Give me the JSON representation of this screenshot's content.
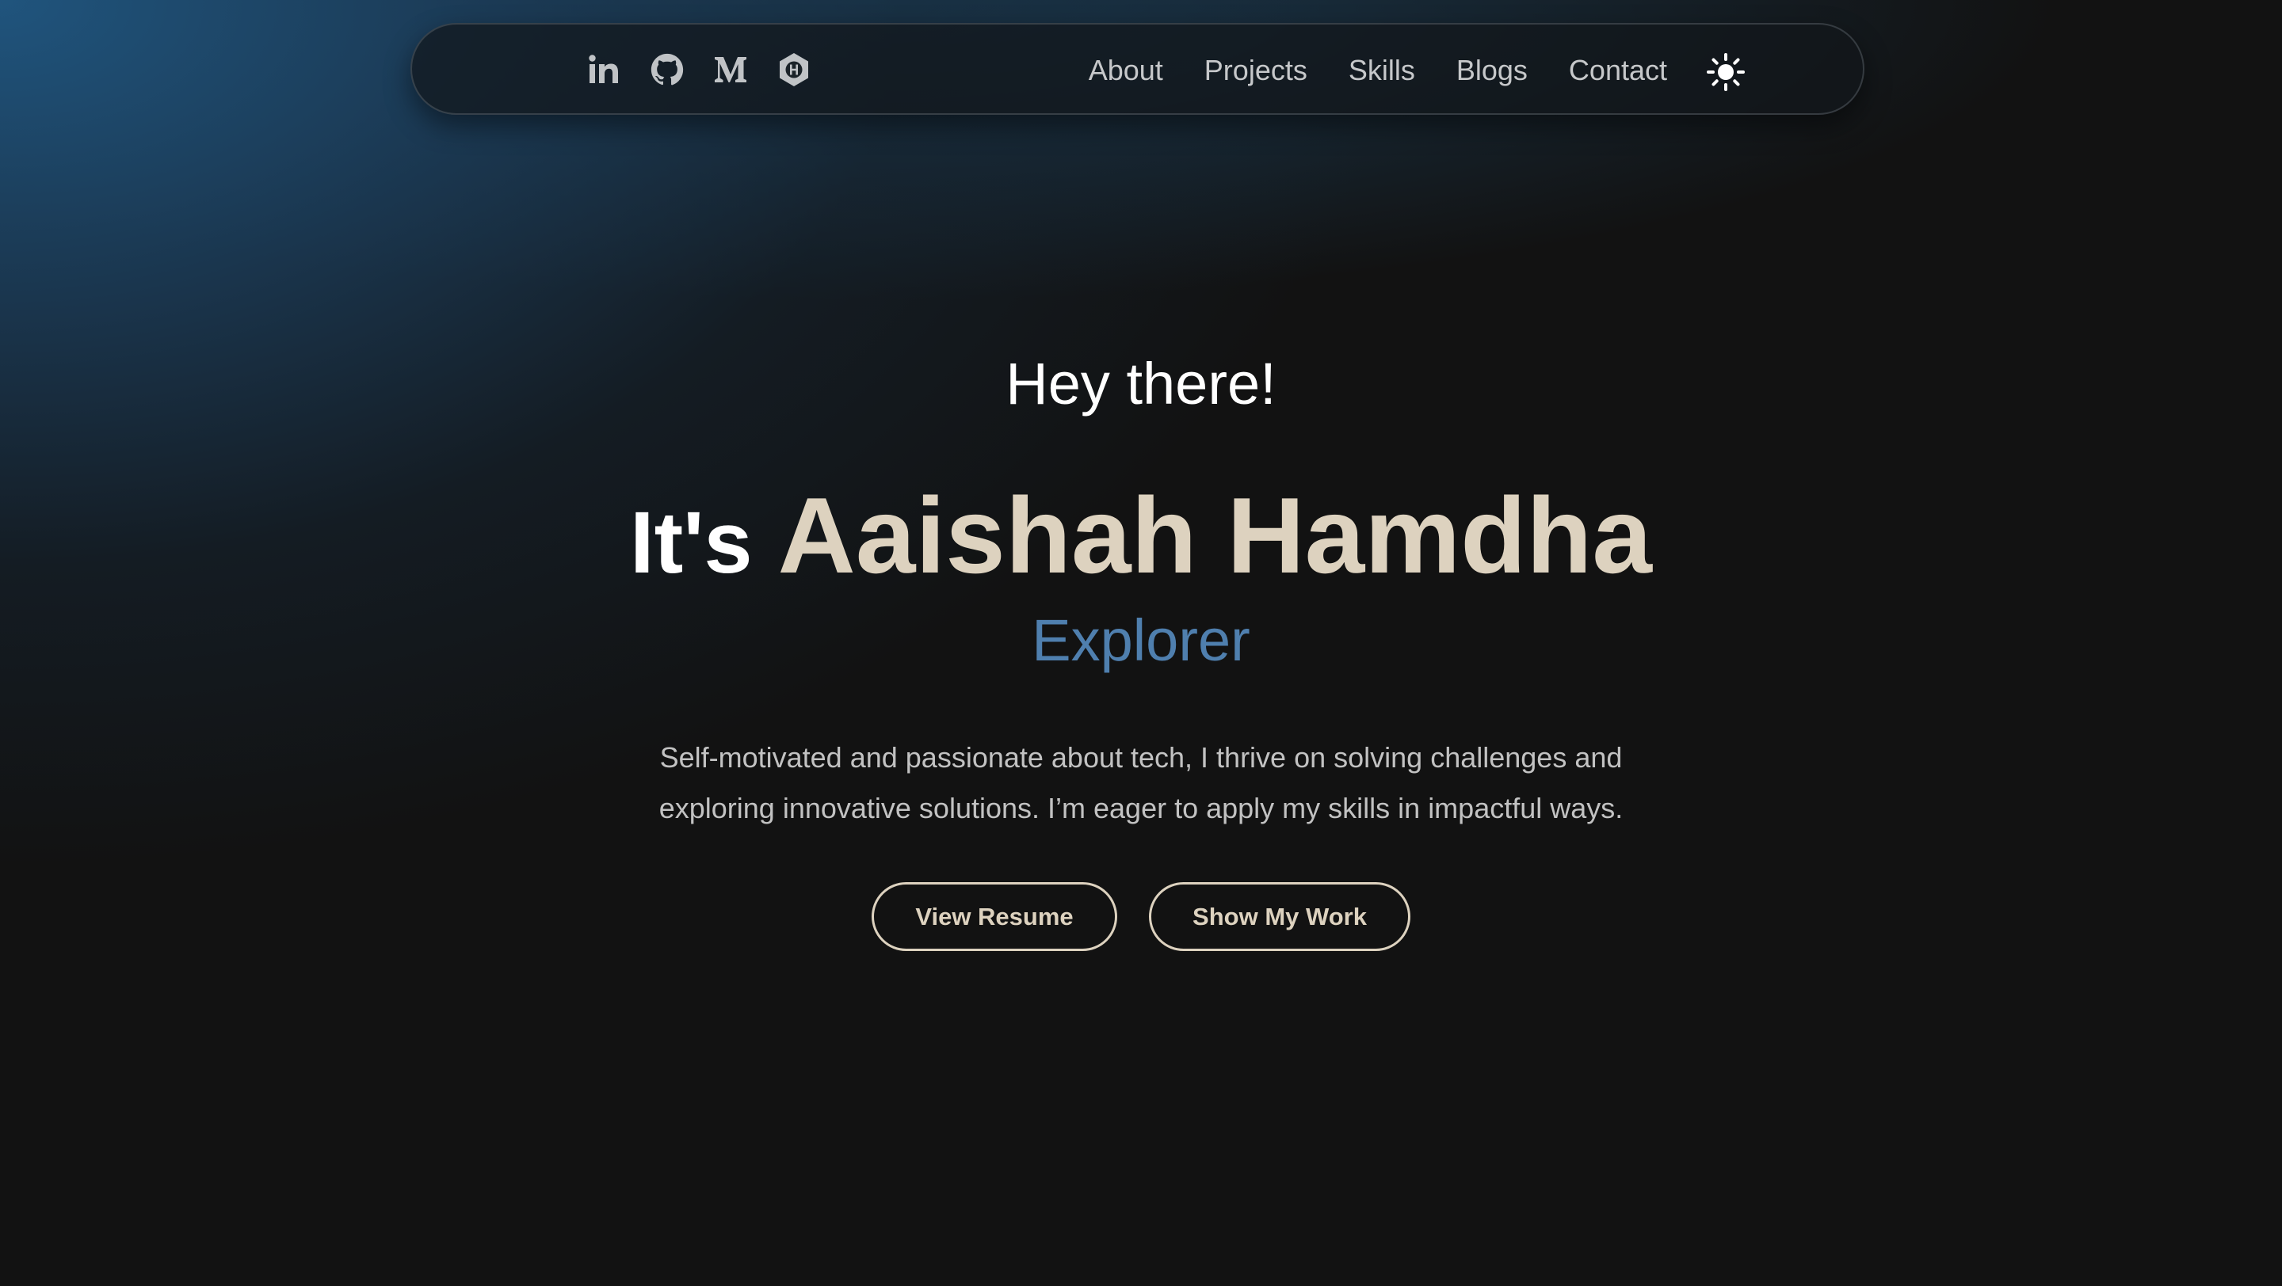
{
  "navbar": {
    "social_icons": [
      {
        "name": "linkedin-icon"
      },
      {
        "name": "github-icon"
      },
      {
        "name": "medium-icon"
      },
      {
        "name": "hashnode-icon"
      }
    ],
    "links": [
      {
        "label": "About"
      },
      {
        "label": "Projects"
      },
      {
        "label": "Skills"
      },
      {
        "label": "Blogs"
      },
      {
        "label": "Contact"
      }
    ],
    "theme_toggle_icon": "sun-icon"
  },
  "hero": {
    "greeting": "Hey there!",
    "prefix": "It's",
    "name": "Aaishah Hamdha",
    "role": "Explorer",
    "bio": "Self-motivated and passionate about tech, I thrive on solving challenges and exploring innovative solutions. I’m eager to apply my skills in impactful ways.",
    "buttons": {
      "resume": "View Resume",
      "work": "Show My Work"
    }
  },
  "colors": {
    "background": "#121212",
    "accent_sand": "#ddd2bf",
    "accent_blue": "#4f7fae",
    "gradient_blue": "#205680",
    "nav_text": "#c6c8ca",
    "body_text": "#c2c2c2"
  }
}
